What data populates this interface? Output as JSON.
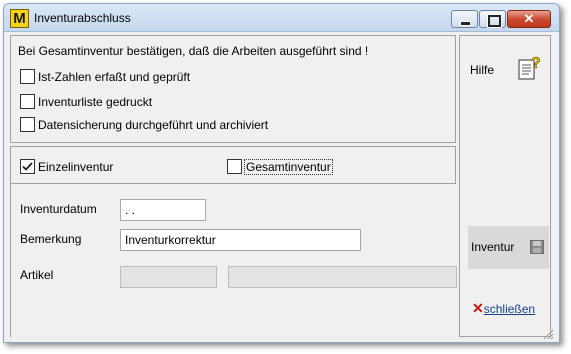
{
  "window": {
    "title": "Inventurabschluss",
    "logo_letter": "M"
  },
  "checklist": {
    "heading": "Bei Gesamtinventur bestätigen, daß die Arbeiten ausgeführt sind !",
    "items": [
      {
        "label": "Ist-Zahlen erfaßt und geprüft",
        "checked": false
      },
      {
        "label": "Inventurliste gedruckt",
        "checked": false
      },
      {
        "label": "Datensicherung durchgeführt und archiviert",
        "checked": false
      }
    ]
  },
  "inventory_type": {
    "single": {
      "label": "Einzelinventur",
      "checked": true
    },
    "total": {
      "label": "Gesamtinventur",
      "checked": false
    }
  },
  "fields": {
    "date_label": "Inventurdatum",
    "date_value": " .  .",
    "remark_label": "Bemerkung",
    "remark_value": "Inventurkorrektur",
    "article_label": "Artikel",
    "article_value_1": "",
    "article_value_2": ""
  },
  "side": {
    "help_label": "Hilfe",
    "help_icon": "help-document-icon",
    "inventur_label": "Inventur",
    "inventur_icon": "save-disk-icon",
    "close_label": "schließen",
    "close_icon": "red-x-icon"
  },
  "colors": {
    "close_x": "#cc1111",
    "link_blue": "#15428b",
    "logo_yellow": "#f7d21a"
  }
}
